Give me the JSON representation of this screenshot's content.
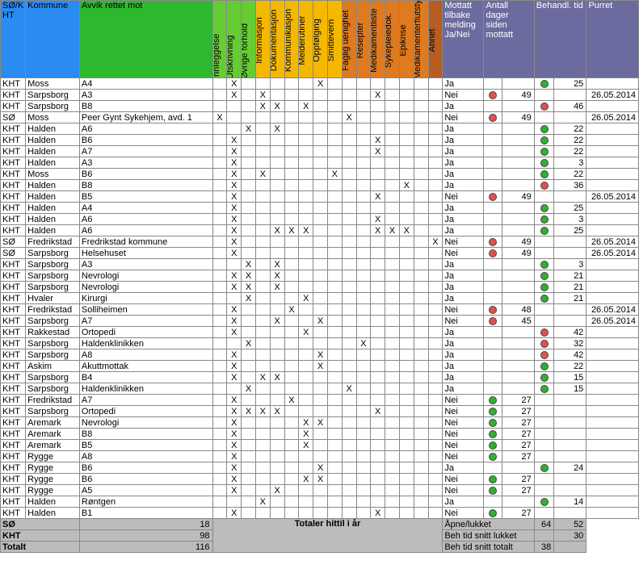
{
  "headers": {
    "col1": "SØ/K\nHT",
    "col2": "Kommune",
    "col3": "Avvik rettet mot",
    "narrow": [
      "Innleggelse",
      "Utskrivning",
      "Øvrige forhold",
      "Informasjon",
      "Dokumentasjon",
      "Kommunikasjon",
      "Melderutiner",
      "Oppfølging",
      "Smittevern",
      "Faglig uenighet",
      "Resepter",
      "Medikamentliste",
      "Sykepleiedok.",
      "Epikrise",
      "Medikamenterflutstyr",
      "Annet"
    ],
    "p1": "Mottatt tilbake melding Ja/Nei",
    "p2": "Antall dager siden mottatt",
    "p3": "Behandl. tid",
    "p4": "Purret"
  },
  "rows": [
    {
      "a": "KHT",
      "b": "Moss",
      "c": "A4",
      "x": [
        0,
        1,
        0,
        0,
        0,
        0,
        0,
        1,
        0,
        0,
        0,
        0,
        0,
        0,
        0,
        0
      ],
      "m": "Ja",
      "dot1": "",
      "d": "",
      "dot2": "green",
      "bt": "25",
      "pu": ""
    },
    {
      "a": "KHT",
      "b": "Sarpsborg",
      "c": "A3",
      "x": [
        0,
        1,
        0,
        1,
        0,
        0,
        0,
        0,
        0,
        0,
        0,
        1,
        0,
        0,
        0,
        0
      ],
      "m": "Nei",
      "dot1": "red",
      "d": "49",
      "dot2": "",
      "bt": "",
      "pu": "26.05.2014"
    },
    {
      "a": "KHT",
      "b": "Sarpsborg",
      "c": "B8",
      "x": [
        0,
        0,
        0,
        1,
        1,
        0,
        1,
        0,
        0,
        0,
        0,
        0,
        0,
        0,
        0,
        0
      ],
      "m": "Ja",
      "dot1": "",
      "d": "",
      "dot2": "red",
      "bt": "46",
      "pu": ""
    },
    {
      "a": "SØ",
      "b": "Moss",
      "c": "Peer Gynt Sykehjem, avd. 1",
      "x": [
        1,
        0,
        0,
        0,
        0,
        0,
        0,
        0,
        0,
        1,
        0,
        0,
        0,
        0,
        0,
        0
      ],
      "m": "Nei",
      "dot1": "red",
      "d": "49",
      "dot2": "",
      "bt": "",
      "pu": "26.05.2014"
    },
    {
      "a": "KHT",
      "b": "Halden",
      "c": "A6",
      "x": [
        0,
        0,
        1,
        0,
        1,
        0,
        0,
        0,
        0,
        0,
        0,
        0,
        0,
        0,
        0,
        0
      ],
      "m": "Ja",
      "dot1": "",
      "d": "",
      "dot2": "green",
      "bt": "22",
      "pu": ""
    },
    {
      "a": "KHT",
      "b": "Halden",
      "c": "B6",
      "x": [
        0,
        1,
        0,
        0,
        0,
        0,
        0,
        0,
        0,
        0,
        0,
        1,
        0,
        0,
        0,
        0
      ],
      "m": "Ja",
      "dot1": "",
      "d": "",
      "dot2": "green",
      "bt": "22",
      "pu": ""
    },
    {
      "a": "KHT",
      "b": "Halden",
      "c": "A7",
      "x": [
        0,
        1,
        0,
        0,
        0,
        0,
        0,
        0,
        0,
        0,
        0,
        1,
        0,
        0,
        0,
        0
      ],
      "m": "Ja",
      "dot1": "",
      "d": "",
      "dot2": "green",
      "bt": "22",
      "pu": ""
    },
    {
      "a": "KHT",
      "b": "Halden",
      "c": "A3",
      "x": [
        0,
        1,
        0,
        0,
        0,
        0,
        0,
        0,
        0,
        0,
        0,
        0,
        0,
        0,
        0,
        0
      ],
      "m": "Ja",
      "dot1": "",
      "d": "",
      "dot2": "green",
      "bt": "3",
      "pu": ""
    },
    {
      "a": "KHT",
      "b": "Moss",
      "c": "B6",
      "x": [
        0,
        1,
        0,
        1,
        0,
        0,
        0,
        0,
        1,
        0,
        0,
        0,
        0,
        0,
        0,
        0
      ],
      "m": "Ja",
      "dot1": "",
      "d": "",
      "dot2": "green",
      "bt": "22",
      "pu": ""
    },
    {
      "a": "KHT",
      "b": "Halden",
      "c": "B8",
      "x": [
        0,
        1,
        0,
        0,
        0,
        0,
        0,
        0,
        0,
        0,
        0,
        0,
        0,
        1,
        0,
        0
      ],
      "m": "Ja",
      "dot1": "",
      "d": "",
      "dot2": "red",
      "bt": "36",
      "pu": ""
    },
    {
      "a": "KHT",
      "b": "Halden",
      "c": "B5",
      "x": [
        0,
        1,
        0,
        0,
        0,
        0,
        0,
        0,
        0,
        0,
        0,
        1,
        0,
        0,
        0,
        0
      ],
      "m": "Nei",
      "dot1": "red",
      "d": "49",
      "dot2": "",
      "bt": "",
      "pu": "26.05.2014"
    },
    {
      "a": "KHT",
      "b": "Halden",
      "c": "A4",
      "x": [
        0,
        1,
        0,
        0,
        0,
        0,
        0,
        0,
        0,
        0,
        0,
        0,
        0,
        0,
        0,
        0
      ],
      "m": "Ja",
      "dot1": "",
      "d": "",
      "dot2": "green",
      "bt": "25",
      "pu": ""
    },
    {
      "a": "KHT",
      "b": "Halden",
      "c": "A6",
      "x": [
        0,
        1,
        0,
        0,
        0,
        0,
        0,
        0,
        0,
        0,
        0,
        1,
        0,
        0,
        0,
        0
      ],
      "m": "Ja",
      "dot1": "",
      "d": "",
      "dot2": "green",
      "bt": "3",
      "pu": ""
    },
    {
      "a": "KHT",
      "b": "Halden",
      "c": "A6",
      "x": [
        0,
        1,
        0,
        0,
        1,
        1,
        1,
        0,
        0,
        0,
        0,
        1,
        1,
        1,
        0,
        0
      ],
      "m": "Ja",
      "dot1": "",
      "d": "",
      "dot2": "green",
      "bt": "25",
      "pu": ""
    },
    {
      "a": "SØ",
      "b": "Fredrikstad",
      "c": "Fredrikstad kommune",
      "x": [
        0,
        1,
        0,
        0,
        0,
        0,
        0,
        0,
        0,
        0,
        0,
        0,
        0,
        0,
        0,
        1
      ],
      "m": "Nei",
      "dot1": "red",
      "d": "49",
      "dot2": "",
      "bt": "",
      "pu": "26.05.2014"
    },
    {
      "a": "SØ",
      "b": "Sarpsborg",
      "c": "Helsehuset",
      "x": [
        0,
        1,
        0,
        0,
        0,
        0,
        0,
        0,
        0,
        0,
        0,
        0,
        0,
        0,
        0,
        0
      ],
      "m": "Nei",
      "dot1": "red",
      "d": "49",
      "dot2": "",
      "bt": "",
      "pu": "26.05.2014"
    },
    {
      "a": "KHT",
      "b": "Sarpsborg",
      "c": "A3",
      "x": [
        0,
        0,
        1,
        0,
        1,
        0,
        0,
        0,
        0,
        0,
        0,
        0,
        0,
        0,
        0,
        0
      ],
      "m": "Ja",
      "dot1": "",
      "d": "",
      "dot2": "green",
      "bt": "3",
      "pu": ""
    },
    {
      "a": "KHT",
      "b": "Sarpsborg",
      "c": "Nevrologi",
      "x": [
        0,
        1,
        1,
        0,
        1,
        0,
        0,
        0,
        0,
        0,
        0,
        0,
        0,
        0,
        0,
        0
      ],
      "m": "Ja",
      "dot1": "",
      "d": "",
      "dot2": "green",
      "bt": "21",
      "pu": ""
    },
    {
      "a": "KHT",
      "b": "Sarpsborg",
      "c": "Nevrologi",
      "x": [
        0,
        1,
        1,
        0,
        1,
        0,
        0,
        0,
        0,
        0,
        0,
        0,
        0,
        0,
        0,
        0
      ],
      "m": "Ja",
      "dot1": "",
      "d": "",
      "dot2": "green",
      "bt": "21",
      "pu": ""
    },
    {
      "a": "KHT",
      "b": "Hvaler",
      "c": "Kirurgi",
      "x": [
        0,
        0,
        1,
        0,
        0,
        0,
        1,
        0,
        0,
        0,
        0,
        0,
        0,
        0,
        0,
        0
      ],
      "m": "Ja",
      "dot1": "",
      "d": "",
      "dot2": "green",
      "bt": "21",
      "pu": ""
    },
    {
      "a": "KHT",
      "b": "Fredrikstad",
      "c": "Solliheimen",
      "x": [
        0,
        1,
        0,
        0,
        0,
        1,
        0,
        0,
        0,
        0,
        0,
        0,
        0,
        0,
        0,
        0
      ],
      "m": "Nei",
      "dot1": "red",
      "d": "48",
      "dot2": "",
      "bt": "",
      "pu": "26.05.2014"
    },
    {
      "a": "KHT",
      "b": "Sarpsborg",
      "c": "A7",
      "x": [
        0,
        1,
        0,
        0,
        1,
        0,
        0,
        1,
        0,
        0,
        0,
        0,
        0,
        0,
        0,
        0
      ],
      "m": "Nei",
      "dot1": "red",
      "d": "45",
      "dot2": "",
      "bt": "",
      "pu": "26.05.2014"
    },
    {
      "a": "KHT",
      "b": "Rakkestad",
      "c": "Ortopedi",
      "x": [
        0,
        1,
        0,
        0,
        0,
        0,
        1,
        0,
        0,
        0,
        0,
        0,
        0,
        0,
        0,
        0
      ],
      "m": "Ja",
      "dot1": "",
      "d": "",
      "dot2": "red",
      "bt": "42",
      "pu": ""
    },
    {
      "a": "KHT",
      "b": "Sarpsborg",
      "c": "Haldenklinikken",
      "x": [
        0,
        0,
        1,
        0,
        0,
        0,
        0,
        0,
        0,
        0,
        1,
        0,
        0,
        0,
        0,
        0
      ],
      "m": "Ja",
      "dot1": "",
      "d": "",
      "dot2": "red",
      "bt": "32",
      "pu": ""
    },
    {
      "a": "KHT",
      "b": "Sarpsborg",
      "c": "A8",
      "x": [
        0,
        1,
        0,
        0,
        0,
        0,
        0,
        1,
        0,
        0,
        0,
        0,
        0,
        0,
        0,
        0
      ],
      "m": "Ja",
      "dot1": "",
      "d": "",
      "dot2": "red",
      "bt": "42",
      "pu": ""
    },
    {
      "a": "KHT",
      "b": "Askim",
      "c": "Akuttmottak",
      "x": [
        0,
        1,
        0,
        0,
        0,
        0,
        0,
        1,
        0,
        0,
        0,
        0,
        0,
        0,
        0,
        0
      ],
      "m": "Ja",
      "dot1": "",
      "d": "",
      "dot2": "green",
      "bt": "22",
      "pu": ""
    },
    {
      "a": "KHT",
      "b": "Sarpsborg",
      "c": "B4",
      "x": [
        0,
        1,
        0,
        1,
        1,
        0,
        0,
        0,
        0,
        0,
        0,
        0,
        0,
        0,
        0,
        0
      ],
      "m": "Ja",
      "dot1": "",
      "d": "",
      "dot2": "green",
      "bt": "15",
      "pu": ""
    },
    {
      "a": "KHT",
      "b": "Sarpsborg",
      "c": "Haldenklinikken",
      "x": [
        0,
        0,
        1,
        0,
        0,
        0,
        0,
        0,
        0,
        1,
        0,
        0,
        0,
        0,
        0,
        0
      ],
      "m": "Ja",
      "dot1": "",
      "d": "",
      "dot2": "green",
      "bt": "15",
      "pu": ""
    },
    {
      "a": "KHT",
      "b": "Fredrikstad",
      "c": "A7",
      "x": [
        0,
        1,
        0,
        0,
        0,
        1,
        0,
        0,
        0,
        0,
        0,
        0,
        0,
        0,
        0,
        0
      ],
      "m": "Nei",
      "dot1": "green",
      "d": "27",
      "dot2": "",
      "bt": "",
      "pu": ""
    },
    {
      "a": "KHT",
      "b": "Sarpsborg",
      "c": "Ortopedi",
      "x": [
        0,
        1,
        1,
        1,
        1,
        0,
        0,
        0,
        0,
        0,
        0,
        1,
        0,
        0,
        0,
        0
      ],
      "m": "Nei",
      "dot1": "green",
      "d": "27",
      "dot2": "",
      "bt": "",
      "pu": ""
    },
    {
      "a": "KHT",
      "b": "Aremark",
      "c": "Nevrologi",
      "x": [
        0,
        1,
        0,
        0,
        0,
        0,
        1,
        1,
        0,
        0,
        0,
        0,
        0,
        0,
        0,
        0
      ],
      "m": "Nei",
      "dot1": "green",
      "d": "27",
      "dot2": "",
      "bt": "",
      "pu": ""
    },
    {
      "a": "KHT",
      "b": "Aremark",
      "c": "B8",
      "x": [
        0,
        1,
        0,
        0,
        0,
        0,
        1,
        0,
        0,
        0,
        0,
        0,
        0,
        0,
        0,
        0
      ],
      "m": "Nei",
      "dot1": "green",
      "d": "27",
      "dot2": "",
      "bt": "",
      "pu": ""
    },
    {
      "a": "KHT",
      "b": "Aremark",
      "c": "B5",
      "x": [
        0,
        1,
        0,
        0,
        0,
        0,
        1,
        0,
        0,
        0,
        0,
        0,
        0,
        0,
        0,
        0
      ],
      "m": "Nei",
      "dot1": "green",
      "d": "27",
      "dot2": "",
      "bt": "",
      "pu": ""
    },
    {
      "a": "KHT",
      "b": "Rygge",
      "c": "A8",
      "x": [
        0,
        1,
        0,
        0,
        0,
        0,
        0,
        0,
        0,
        0,
        0,
        0,
        0,
        0,
        0,
        0
      ],
      "m": "Nei",
      "dot1": "green",
      "d": "27",
      "dot2": "",
      "bt": "",
      "pu": ""
    },
    {
      "a": "KHT",
      "b": "Rygge",
      "c": "B6",
      "x": [
        0,
        1,
        0,
        0,
        0,
        0,
        0,
        1,
        0,
        0,
        0,
        0,
        0,
        0,
        0,
        0
      ],
      "m": "Ja",
      "dot1": "",
      "d": "",
      "dot2": "green",
      "bt": "24",
      "pu": ""
    },
    {
      "a": "KHT",
      "b": "Rygge",
      "c": "B6",
      "x": [
        0,
        1,
        0,
        0,
        0,
        0,
        1,
        1,
        0,
        0,
        0,
        0,
        0,
        0,
        0,
        0
      ],
      "m": "Nei",
      "dot1": "green",
      "d": "27",
      "dot2": "",
      "bt": "",
      "pu": ""
    },
    {
      "a": "KHT",
      "b": "Rygge",
      "c": "A5",
      "x": [
        0,
        1,
        0,
        0,
        1,
        0,
        0,
        0,
        0,
        0,
        0,
        0,
        0,
        0,
        0,
        0
      ],
      "m": "Nei",
      "dot1": "green",
      "d": "27",
      "dot2": "",
      "bt": "",
      "pu": ""
    },
    {
      "a": "KHT",
      "b": "Halden",
      "c": "Røntgen",
      "x": [
        0,
        0,
        0,
        1,
        0,
        0,
        0,
        0,
        0,
        0,
        0,
        0,
        0,
        0,
        0,
        0
      ],
      "m": "Ja",
      "dot1": "",
      "d": "",
      "dot2": "green",
      "bt": "14",
      "pu": ""
    },
    {
      "a": "KHT",
      "b": "Halden",
      "c": "B1",
      "x": [
        0,
        1,
        0,
        0,
        0,
        0,
        0,
        0,
        0,
        0,
        0,
        1,
        0,
        0,
        0,
        0
      ],
      "m": "Nei",
      "dot1": "green",
      "d": "27",
      "dot2": "",
      "bt": "",
      "pu": ""
    }
  ],
  "footer": {
    "l1a": "SØ",
    "l1b": "18",
    "l2a": "KHT",
    "l2b": "98",
    "l3a": "Totalt",
    "l3b": "116",
    "center": "Totaler hittil i år",
    "r1a": "Åpne/lukket",
    "r1b": "64",
    "r1c": "52",
    "r2a": "Beh tid snitt lukket",
    "r2b": "",
    "r2c": "30",
    "r3a": "Beh tid snitt totalt",
    "r3b": "38",
    "r3c": ""
  }
}
